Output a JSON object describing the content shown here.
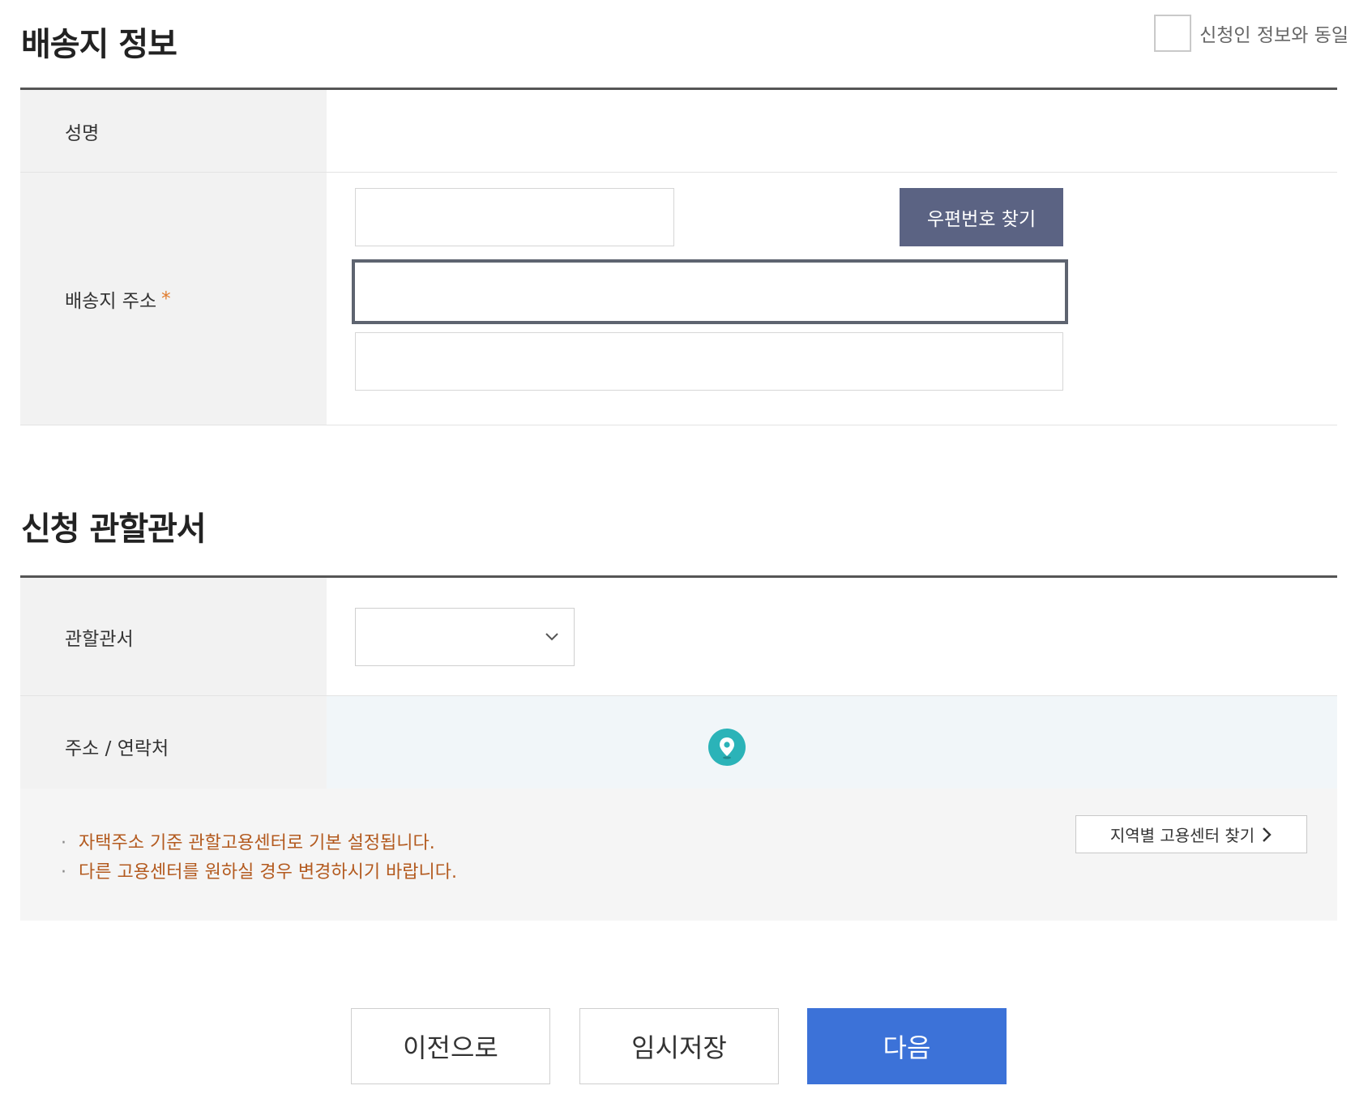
{
  "shipping": {
    "title": "배송지 정보",
    "same_as_applicant_label": "신청인 정보와 동일",
    "name_label": "성명",
    "address_label": "배송지 주소",
    "required_mark": "*",
    "zip_button": "우편번호 찾기"
  },
  "office": {
    "title": "신청 관할관서",
    "office_label": "관할관서",
    "contact_label": "주소 / 연락처",
    "notices": [
      "자택주소 기준 관할고용센터로 기본 설정됩니다.",
      "다른 고용센터를 원하실 경우 변경하시기 바랍니다."
    ],
    "region_button": "지역별 고용센터 찾기"
  },
  "actions": {
    "prev": "이전으로",
    "temp_save": "임시저장",
    "next": "다음"
  },
  "colors": {
    "primary": "#3c72d8",
    "zip_button": "#5b6383",
    "notice_text": "#b35a1f",
    "required": "#e07b2c",
    "pin": "#2bb3b8"
  },
  "icons": [
    "checkbox",
    "map-pin-icon",
    "chevron-down-icon",
    "chevron-right-icon"
  ]
}
